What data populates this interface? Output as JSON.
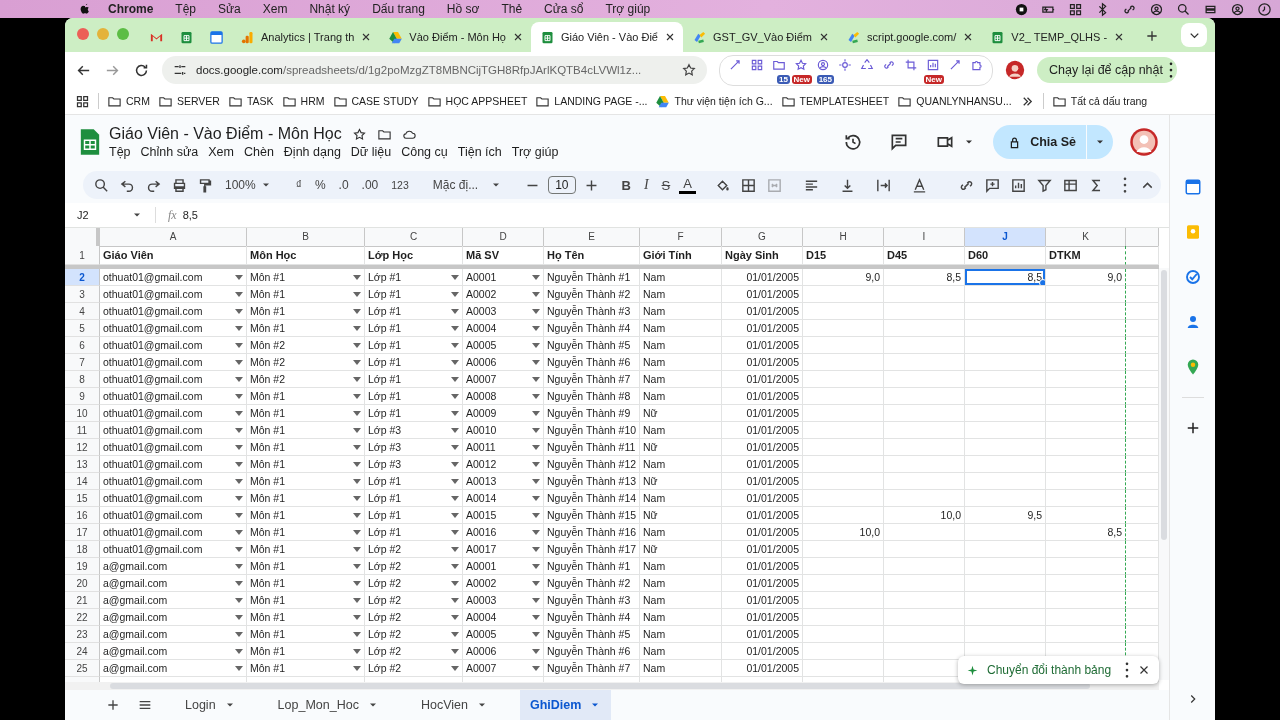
{
  "mac_menu": {
    "app": "Chrome",
    "items": [
      "Tệp",
      "Sửa",
      "Xem",
      "Nhật ký",
      "Dấu trang",
      "Hồ sơ",
      "Thẻ",
      "Cửa sổ",
      "Trợ giúp"
    ]
  },
  "browser_tabs": [
    {
      "title": "Analytics | Trang th",
      "kind": "analytics",
      "selected": false
    },
    {
      "title": "Vào Điểm - Môn Họ",
      "kind": "drive",
      "selected": false
    },
    {
      "title": "Giáo Viên - Vào Điể",
      "kind": "sheets",
      "selected": true
    },
    {
      "title": "GST_GV_Vào Điểm",
      "kind": "script",
      "selected": false
    },
    {
      "title": "script.google.com/",
      "kind": "script",
      "selected": false
    },
    {
      "title": "V2_ TEMP_QLHS -",
      "kind": "sheets",
      "selected": false
    }
  ],
  "address": {
    "host": "docs.google.com",
    "path": "/spreadsheets/d/1g2poMzgZT8MBNCijTGH8RfpJArlKQTB4cLVWl1z..."
  },
  "extension_badges": [
    "15",
    "New",
    "165",
    "New"
  ],
  "update_button": "Chạy lại để cập nhật",
  "bookmarks": [
    {
      "label": "CRM",
      "kind": "folder"
    },
    {
      "label": "SERVER",
      "kind": "folder"
    },
    {
      "label": "TASK",
      "kind": "folder"
    },
    {
      "label": "HRM",
      "kind": "folder"
    },
    {
      "label": "CASE STUDY",
      "kind": "folder"
    },
    {
      "label": "HỌC APPSHEET",
      "kind": "folder"
    },
    {
      "label": "LANDING PAGE -...",
      "kind": "folder"
    },
    {
      "label": "Thư viện tiện ích G...",
      "kind": "drive"
    },
    {
      "label": "TEMPLATESHEET",
      "kind": "folder"
    },
    {
      "label": "QUANLYNHANSU...",
      "kind": "folder"
    }
  ],
  "all_bookmarks": "Tất cả dấu trang",
  "doc": {
    "title": "Giáo Viên - Vào Điểm - Môn Học",
    "menus": [
      "Tệp",
      "Chỉnh sửa",
      "Xem",
      "Chèn",
      "Định dạng",
      "Dữ liệu",
      "Công cụ",
      "Tiện ích",
      "Trợ giúp"
    ],
    "share": "Chia Sẻ"
  },
  "toolbar": {
    "zoom": "100%",
    "currency": "₫",
    "percent": "%",
    "decimal_decrease": ".0",
    "decimal_increase": ".00",
    "number_format": "123",
    "font": "Mặc đị...",
    "font_size": "10",
    "bold": "B",
    "italic": "I",
    "strikethrough": "S",
    "text_color": "A"
  },
  "formula_bar": {
    "cell_ref": "J2",
    "fx": "fx",
    "value": "8,5"
  },
  "sheet": {
    "columns": [
      {
        "letter": "A",
        "header": "Giáo Viên",
        "kind": "dropdown",
        "selected": false
      },
      {
        "letter": "B",
        "header": "Môn Học",
        "kind": "dropdown",
        "selected": false
      },
      {
        "letter": "C",
        "header": "Lớp Học",
        "kind": "dropdown",
        "selected": false
      },
      {
        "letter": "D",
        "header": "Mã SV",
        "kind": "dropdown",
        "selected": false
      },
      {
        "letter": "E",
        "header": "Họ Tên",
        "kind": "text",
        "selected": false
      },
      {
        "letter": "F",
        "header": "Giới Tính",
        "kind": "text",
        "selected": false
      },
      {
        "letter": "G",
        "header": "Ngày Sinh",
        "kind": "number",
        "selected": false
      },
      {
        "letter": "H",
        "header": "D15",
        "kind": "number",
        "selected": false
      },
      {
        "letter": "I",
        "header": "D45",
        "kind": "number",
        "selected": false
      },
      {
        "letter": "J",
        "header": "D60",
        "kind": "number",
        "selected": true
      },
      {
        "letter": "K",
        "header": "DTKM",
        "kind": "number",
        "selected": false
      }
    ],
    "header_row": "1",
    "rows": [
      {
        "number": "2",
        "selected": true,
        "cells": [
          "othuat01@gmail.com",
          "Môn #1",
          "Lớp #1",
          "A0001",
          "Nguyễn Thành #1",
          "Nam",
          "01/01/2005",
          "9,0",
          "8,5",
          "8,5",
          "9,0"
        ]
      },
      {
        "number": "3",
        "selected": false,
        "cells": [
          "othuat01@gmail.com",
          "Môn #1",
          "Lớp #1",
          "A0002",
          "Nguyễn Thành #2",
          "Nam",
          "01/01/2005",
          null,
          null,
          null,
          null
        ]
      },
      {
        "number": "4",
        "selected": false,
        "cells": [
          "othuat01@gmail.com",
          "Môn #1",
          "Lớp #1",
          "A0003",
          "Nguyễn Thành #3",
          "Nam",
          "01/01/2005",
          null,
          null,
          null,
          null
        ]
      },
      {
        "number": "5",
        "selected": false,
        "cells": [
          "othuat01@gmail.com",
          "Môn #1",
          "Lớp #1",
          "A0004",
          "Nguyễn Thành #4",
          "Nam",
          "01/01/2005",
          null,
          null,
          null,
          null
        ]
      },
      {
        "number": "6",
        "selected": false,
        "cells": [
          "othuat01@gmail.com",
          "Môn #2",
          "Lớp #1",
          "A0005",
          "Nguyễn Thành #5",
          "Nam",
          "01/01/2005",
          null,
          null,
          null,
          null
        ]
      },
      {
        "number": "7",
        "selected": false,
        "cells": [
          "othuat01@gmail.com",
          "Môn #2",
          "Lớp #1",
          "A0006",
          "Nguyễn Thành #6",
          "Nam",
          "01/01/2005",
          null,
          null,
          null,
          null
        ]
      },
      {
        "number": "8",
        "selected": false,
        "cells": [
          "othuat01@gmail.com",
          "Môn #2",
          "Lớp #1",
          "A0007",
          "Nguyễn Thành #7",
          "Nam",
          "01/01/2005",
          null,
          null,
          null,
          null
        ]
      },
      {
        "number": "9",
        "selected": false,
        "cells": [
          "othuat01@gmail.com",
          "Môn #1",
          "Lớp #1",
          "A0008",
          "Nguyễn Thành #8",
          "Nam",
          "01/01/2005",
          null,
          null,
          null,
          null
        ]
      },
      {
        "number": "10",
        "selected": false,
        "cells": [
          "othuat01@gmail.com",
          "Môn #1",
          "Lớp #1",
          "A0009",
          "Nguyễn Thành #9",
          "Nữ",
          "01/01/2005",
          null,
          null,
          null,
          null
        ]
      },
      {
        "number": "11",
        "selected": false,
        "cells": [
          "othuat01@gmail.com",
          "Môn #1",
          "Lớp #3",
          "A0010",
          "Nguyễn Thành #10",
          "Nam",
          "01/01/2005",
          null,
          null,
          null,
          null
        ]
      },
      {
        "number": "12",
        "selected": false,
        "cells": [
          "othuat01@gmail.com",
          "Môn #1",
          "Lớp #3",
          "A0011",
          "Nguyễn Thành #11",
          "Nữ",
          "01/01/2005",
          null,
          null,
          null,
          null
        ]
      },
      {
        "number": "13",
        "selected": false,
        "cells": [
          "othuat01@gmail.com",
          "Môn #1",
          "Lớp #3",
          "A0012",
          "Nguyễn Thành #12",
          "Nam",
          "01/01/2005",
          null,
          null,
          null,
          null
        ]
      },
      {
        "number": "14",
        "selected": false,
        "cells": [
          "othuat01@gmail.com",
          "Môn #1",
          "Lớp #1",
          "A0013",
          "Nguyễn Thành #13",
          "Nữ",
          "01/01/2005",
          null,
          null,
          null,
          null
        ]
      },
      {
        "number": "15",
        "selected": false,
        "cells": [
          "othuat01@gmail.com",
          "Môn #1",
          "Lớp #1",
          "A0014",
          "Nguyễn Thành #14",
          "Nam",
          "01/01/2005",
          null,
          null,
          null,
          null
        ]
      },
      {
        "number": "16",
        "selected": false,
        "cells": [
          "othuat01@gmail.com",
          "Môn #1",
          "Lớp #1",
          "A0015",
          "Nguyễn Thành #15",
          "Nữ",
          "01/01/2005",
          null,
          "10,0",
          "9,5",
          null
        ]
      },
      {
        "number": "17",
        "selected": false,
        "cells": [
          "othuat01@gmail.com",
          "Môn #1",
          "Lớp #1",
          "A0016",
          "Nguyễn Thành #16",
          "Nam",
          "01/01/2005",
          "10,0",
          null,
          null,
          "8,5"
        ]
      },
      {
        "number": "18",
        "selected": false,
        "cells": [
          "othuat01@gmail.com",
          "Môn #1",
          "Lớp #2",
          "A0017",
          "Nguyễn Thành #17",
          "Nữ",
          "01/01/2005",
          null,
          null,
          null,
          null
        ]
      },
      {
        "number": "19",
        "selected": false,
        "cells": [
          "a@gmail.com",
          "Môn #1",
          "Lớp #2",
          "A0001",
          "Nguyễn Thành #1",
          "Nam",
          "01/01/2005",
          null,
          null,
          null,
          null
        ]
      },
      {
        "number": "20",
        "selected": false,
        "cells": [
          "a@gmail.com",
          "Môn #1",
          "Lớp #2",
          "A0002",
          "Nguyễn Thành #2",
          "Nam",
          "01/01/2005",
          null,
          null,
          null,
          null
        ]
      },
      {
        "number": "21",
        "selected": false,
        "cells": [
          "a@gmail.com",
          "Môn #1",
          "Lớp #2",
          "A0003",
          "Nguyễn Thành #3",
          "Nam",
          "01/01/2005",
          null,
          null,
          null,
          null
        ]
      },
      {
        "number": "22",
        "selected": false,
        "cells": [
          "a@gmail.com",
          "Môn #1",
          "Lớp #2",
          "A0004",
          "Nguyễn Thành #4",
          "Nam",
          "01/01/2005",
          null,
          null,
          null,
          null
        ]
      },
      {
        "number": "23",
        "selected": false,
        "cells": [
          "a@gmail.com",
          "Môn #1",
          "Lớp #2",
          "A0005",
          "Nguyễn Thành #5",
          "Nam",
          "01/01/2005",
          null,
          null,
          null,
          null
        ]
      },
      {
        "number": "24",
        "selected": false,
        "cells": [
          "a@gmail.com",
          "Môn #1",
          "Lớp #2",
          "A0006",
          "Nguyễn Thành #6",
          "Nam",
          "01/01/2005",
          null,
          null,
          null,
          null
        ]
      },
      {
        "number": "25",
        "selected": false,
        "cells": [
          "a@gmail.com",
          "Môn #1",
          "Lớp #2",
          "A0007",
          "Nguyễn Thành #7",
          "Nam",
          "01/01/2005",
          null,
          null,
          null,
          null
        ]
      }
    ]
  },
  "sheet_tabs": [
    {
      "name": "Login",
      "selected": false
    },
    {
      "name": "Lop_Mon_Hoc",
      "selected": false
    },
    {
      "name": "HocVien",
      "selected": false
    },
    {
      "name": "GhiDiem",
      "selected": true
    }
  ],
  "toast": "Chuyển đổi thành bảng"
}
